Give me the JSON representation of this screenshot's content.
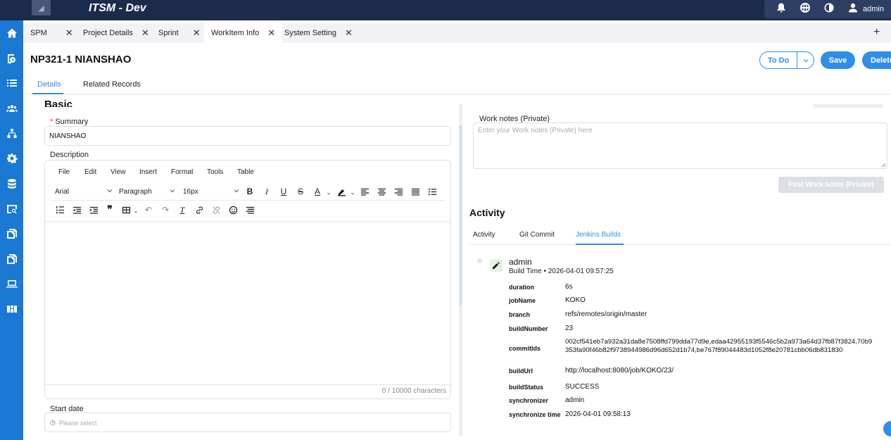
{
  "app": {
    "title": "ITSM - Dev",
    "user": "admin"
  },
  "tabs": [
    {
      "label": "SPM"
    },
    {
      "label": "Project Details"
    },
    {
      "label": "Sprint"
    },
    {
      "label": "WorkItem Info"
    },
    {
      "label": "System Setting"
    }
  ],
  "tab_close": "✕",
  "tab_add": "+",
  "page": {
    "title": "NP321-1 NIANSHAO",
    "status_label": "To Do",
    "save_label": "Save",
    "delete_label": "Delete"
  },
  "subtabs": [
    {
      "label": "Details"
    },
    {
      "label": "Related Records"
    }
  ],
  "form": {
    "section_title": "Basic Information",
    "summary_label": "Summary",
    "summary_required": "*",
    "summary_value": "NIANSHAO",
    "description_label": "Description",
    "start_date_label": "Start date",
    "start_date_placeholder": "Please select"
  },
  "editor": {
    "menus": [
      "File",
      "Edit",
      "View",
      "Insert",
      "Format",
      "Tools",
      "Table"
    ],
    "font_family": "Arial",
    "block_format": "Paragraph",
    "font_size": "16px",
    "char_count": "0 / 10000 characters"
  },
  "worknotes": {
    "label": "Work notes (Private)",
    "placeholder": "Enter your Work notes (Private) here",
    "post_label": "Post Work notes (Private)"
  },
  "activity": {
    "title": "Activity",
    "tabs": [
      {
        "label": "Activity"
      },
      {
        "label": "Git Commit"
      },
      {
        "label": "Jenkins Builds"
      }
    ],
    "entry": {
      "user": "admin",
      "time_label": "Build Time • 2026-04-01 09:57:25",
      "fields": [
        {
          "key": "duration",
          "value": "6s"
        },
        {
          "key": "jobName",
          "value": "KOKO"
        },
        {
          "key": "branch",
          "value": "refs/remotes/origin/master"
        },
        {
          "key": "buildNumber",
          "value": "23"
        },
        {
          "key": "commitIds",
          "value": "002cf541eb7a932a31da8e7508ffd799dda77d9e,edaa42955193f5546c5b2a973a64d37fb87f3824,70b9353fa90f46b82f9738944986d96d652d1b74,be767f89044483d1052f8e20781cbb06db831830"
        },
        {
          "key": "buildUrl",
          "value": "http://localhost:8080/job/KOKO/23/"
        },
        {
          "key": "buildStatus",
          "value": "SUCCESS"
        },
        {
          "key": "synchronizer",
          "value": "admin"
        },
        {
          "key": "synchronize time",
          "value": "2026-04-01 09:58:13"
        }
      ]
    }
  },
  "colors": {
    "accent": "#2f8ee6",
    "sidebar": "#1b79d4",
    "topbar": "#1d2b4a"
  },
  "icons": {
    "sidebar": [
      "home-icon",
      "task-board-icon",
      "list-icon",
      "team-icon",
      "hierarchy-icon",
      "settings-icon",
      "database-icon",
      "search-report-icon",
      "copy-icon",
      "document-icon",
      "laptop-icon",
      "grid-icon"
    ],
    "topbar": [
      "bell-icon",
      "globe-icon",
      "contrast-icon",
      "user-icon"
    ]
  }
}
